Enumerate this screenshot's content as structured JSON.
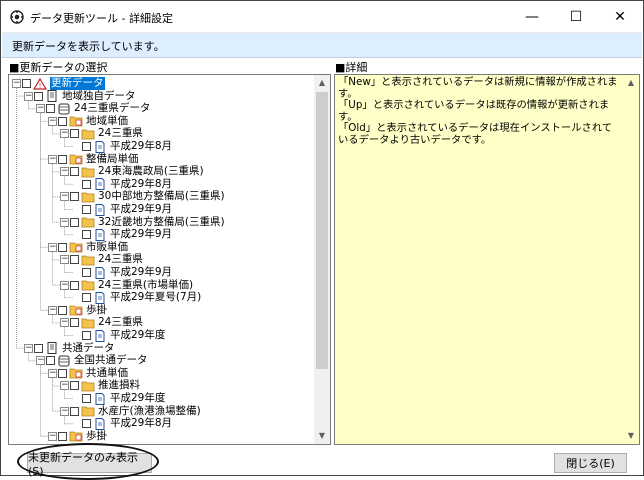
{
  "window": {
    "title": "データ更新ツール - 詳細設定",
    "minimize": "—",
    "maximize": "☐",
    "close": "✕"
  },
  "status": {
    "text": "更新データを表示しています。"
  },
  "left_panel": {
    "title": "■更新データの選択"
  },
  "right_panel": {
    "title": "■詳細",
    "text": "「New」と表示されているデータは新規に情報が作成されます。\n「Up」と表示されているデータは既存の情報が更新されます。\n「Old」と表示されているデータは現在インストールされているデータより古いデータです。"
  },
  "tree": [
    {
      "label": "更新データ",
      "level": 0,
      "toggle": "⊟",
      "icon": "update-icon",
      "selected": true
    },
    {
      "label": "地域独自データ",
      "level": 1,
      "toggle": "⊟",
      "icon": "document-icon"
    },
    {
      "label": "24三重県データ",
      "level": 2,
      "toggle": "⊟",
      "icon": "database-icon"
    },
    {
      "label": "地域単価",
      "level": 3,
      "toggle": "⊟",
      "icon": "folder-grid-icon"
    },
    {
      "label": "24三重県",
      "level": 4,
      "toggle": "⊟",
      "icon": "folder-icon"
    },
    {
      "label": "平成29年8月",
      "level": 5,
      "toggle": "",
      "icon": "file-icon"
    },
    {
      "label": "整備局単価",
      "level": 3,
      "toggle": "⊟",
      "icon": "folder-grid-icon"
    },
    {
      "label": "24東海農政局(三重県)",
      "level": 4,
      "toggle": "⊟",
      "icon": "folder-icon"
    },
    {
      "label": "平成29年8月",
      "level": 5,
      "toggle": "",
      "icon": "file-icon"
    },
    {
      "label": "30中部地方整備局(三重県)",
      "level": 4,
      "toggle": "⊟",
      "icon": "folder-icon"
    },
    {
      "label": "平成29年9月",
      "level": 5,
      "toggle": "",
      "icon": "file-icon"
    },
    {
      "label": "32近畿地方整備局(三重県)",
      "level": 4,
      "toggle": "⊟",
      "icon": "folder-icon"
    },
    {
      "label": "平成29年9月",
      "level": 5,
      "toggle": "",
      "icon": "file-icon"
    },
    {
      "label": "市販単価",
      "level": 3,
      "toggle": "⊟",
      "icon": "folder-grid-icon"
    },
    {
      "label": "24三重県",
      "level": 4,
      "toggle": "⊟",
      "icon": "folder-icon"
    },
    {
      "label": "平成29年9月",
      "level": 5,
      "toggle": "",
      "icon": "file-icon"
    },
    {
      "label": "24三重県(市場単価)",
      "level": 4,
      "toggle": "⊟",
      "icon": "folder-icon"
    },
    {
      "label": "平成29年夏号(7月)",
      "level": 5,
      "toggle": "",
      "icon": "file-icon"
    },
    {
      "label": "歩掛",
      "level": 3,
      "toggle": "⊟",
      "icon": "folder-grid-icon"
    },
    {
      "label": "24三重県",
      "level": 4,
      "toggle": "⊟",
      "icon": "folder-icon"
    },
    {
      "label": "平成29年度",
      "level": 5,
      "toggle": "",
      "icon": "file-icon"
    },
    {
      "label": "共通データ",
      "level": 1,
      "toggle": "⊟",
      "icon": "document-icon"
    },
    {
      "label": "全国共通データ",
      "level": 2,
      "toggle": "⊟",
      "icon": "database-icon"
    },
    {
      "label": "共通単価",
      "level": 3,
      "toggle": "⊟",
      "icon": "folder-grid-icon"
    },
    {
      "label": "推進損料",
      "level": 4,
      "toggle": "⊟",
      "icon": "folder-icon"
    },
    {
      "label": "平成29年度",
      "level": 5,
      "toggle": "",
      "icon": "file-icon"
    },
    {
      "label": "水産庁(漁港漁場整備)",
      "level": 4,
      "toggle": "⊟",
      "icon": "folder-icon"
    },
    {
      "label": "平成29年8月",
      "level": 5,
      "toggle": "",
      "icon": "file-icon"
    },
    {
      "label": "歩掛",
      "level": 3,
      "toggle": "⊟",
      "icon": "folder-grid-icon"
    }
  ],
  "buttons": {
    "unupdated_only": "未更新データのみ表示(S)",
    "close": "閉じる(E)"
  },
  "colors": {
    "status_bg": "#ddeeff",
    "detail_bg": "#ffffc8",
    "selection": "#0078d7",
    "folder": "#f4c34a"
  }
}
